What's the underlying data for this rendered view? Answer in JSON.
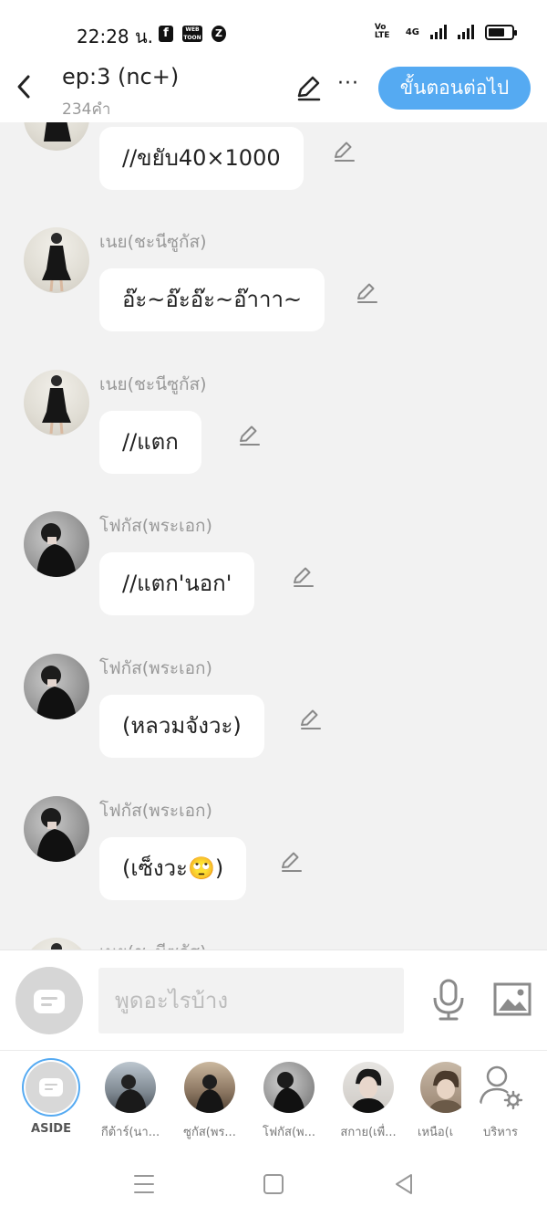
{
  "status_bar": {
    "time": "22:28 น.",
    "app_icons": [
      "f",
      "WEB TOON",
      "Z"
    ],
    "network_labels": [
      "Vo LTE",
      "4G"
    ],
    "battery_level": 0.7
  },
  "header": {
    "title": "ep:3 (nc+)",
    "word_count": "234คำ",
    "more_icon": "···",
    "next_button": "ขั้นตอนต่อไป"
  },
  "messages": [
    {
      "sender": "",
      "text": "//ขยับ40×1000",
      "avatar": "girl"
    },
    {
      "sender": "เนย(ชะนีซูกัส)",
      "text": "อ๊ะ~อ๊ะอ๊ะ~อ๊าาา~",
      "avatar": "girl"
    },
    {
      "sender": "เนย(ชะนีซูกัส)",
      "text": "//แตก",
      "avatar": "girl"
    },
    {
      "sender": "โฟกัส(พระเอก)",
      "text": "//แตก'นอก'",
      "avatar": "boy"
    },
    {
      "sender": "โฟกัส(พระเอก)",
      "text": "(หลวมจังวะ)",
      "avatar": "boy"
    },
    {
      "sender": "โฟกัส(พระเอก)",
      "text": "(เซ็งวะ🙄)",
      "avatar": "boy"
    },
    {
      "sender": "เนย(ชะนีซูกัส)",
      "text": "",
      "avatar": "girl"
    }
  ],
  "input": {
    "placeholder": "พูดอะไรบ้าง",
    "value": ""
  },
  "characters": [
    {
      "name": "ASIDE",
      "selected": true
    },
    {
      "name": "กีต้าร์(นา..."
    },
    {
      "name": "ซูกัส(พร..."
    },
    {
      "name": "โฟกัส(พ..."
    },
    {
      "name": "สกาย(เพื่..."
    },
    {
      "name": "เหนือ(เ"
    },
    {
      "name": "บริหาร"
    }
  ],
  "colors": {
    "accent": "#55aaf2",
    "background": "#f2f2f2",
    "bubble": "#ffffff",
    "sender_text": "#999999"
  },
  "icons": {
    "back": "chevron-left-icon",
    "edit": "pencil-icon",
    "more": "more-horizontal-icon",
    "mic": "microphone-icon",
    "image": "image-icon",
    "manage": "user-settings-icon",
    "aside": "chat-bubble-icon"
  }
}
